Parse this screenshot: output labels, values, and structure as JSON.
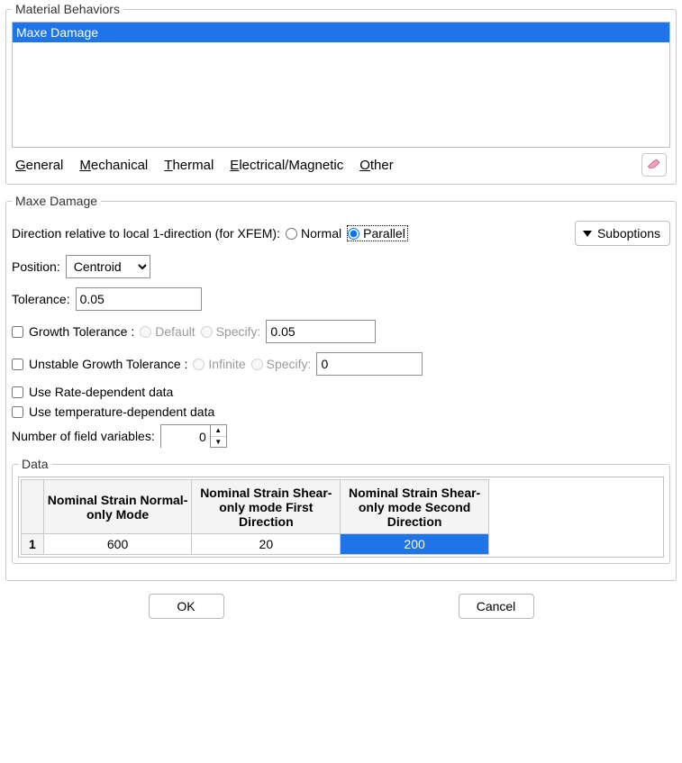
{
  "behaviors": {
    "legend": "Material Behaviors",
    "items": [
      "Maxe Damage"
    ],
    "selected_index": 0
  },
  "menu": {
    "general": "General",
    "mechanical": "Mechanical",
    "thermal": "Thermal",
    "elecmag": "Electrical/Magnetic",
    "other": "Other"
  },
  "damage": {
    "legend": "Maxe Damage",
    "direction_label": "Direction relative to local 1-direction (for XFEM):",
    "normal": "Normal",
    "parallel": "Parallel",
    "direction_value": "Parallel",
    "suboptions": "Suboptions",
    "position_label": "Position:",
    "position_value": "Centroid",
    "tolerance_label": "Tolerance:",
    "tolerance_value": "0.05",
    "growth_tol_label": "Growth Tolerance :",
    "default": "Default",
    "specify": "Specify:",
    "growth_specify_value": "0.05",
    "ug_tol_label": "Unstable Growth Tolerance :",
    "infinite": "Infinite",
    "ug_specify_value": "0",
    "rate_dep": "Use Rate-dependent data",
    "temp_dep": "Use temperature-dependent data",
    "field_vars_label": "Number of field variables:",
    "field_vars_value": "0"
  },
  "data": {
    "legend": "Data",
    "headers": [
      "Nominal Strain Normal-only Mode",
      "Nominal Strain Shear-only mode First Direction",
      "Nominal Strain Shear-only mode Second Direction"
    ],
    "rows": [
      {
        "n": "1",
        "cells": [
          "600",
          "20",
          "200"
        ],
        "selected_col": 2
      }
    ]
  },
  "buttons": {
    "ok": "OK",
    "cancel": "Cancel"
  }
}
